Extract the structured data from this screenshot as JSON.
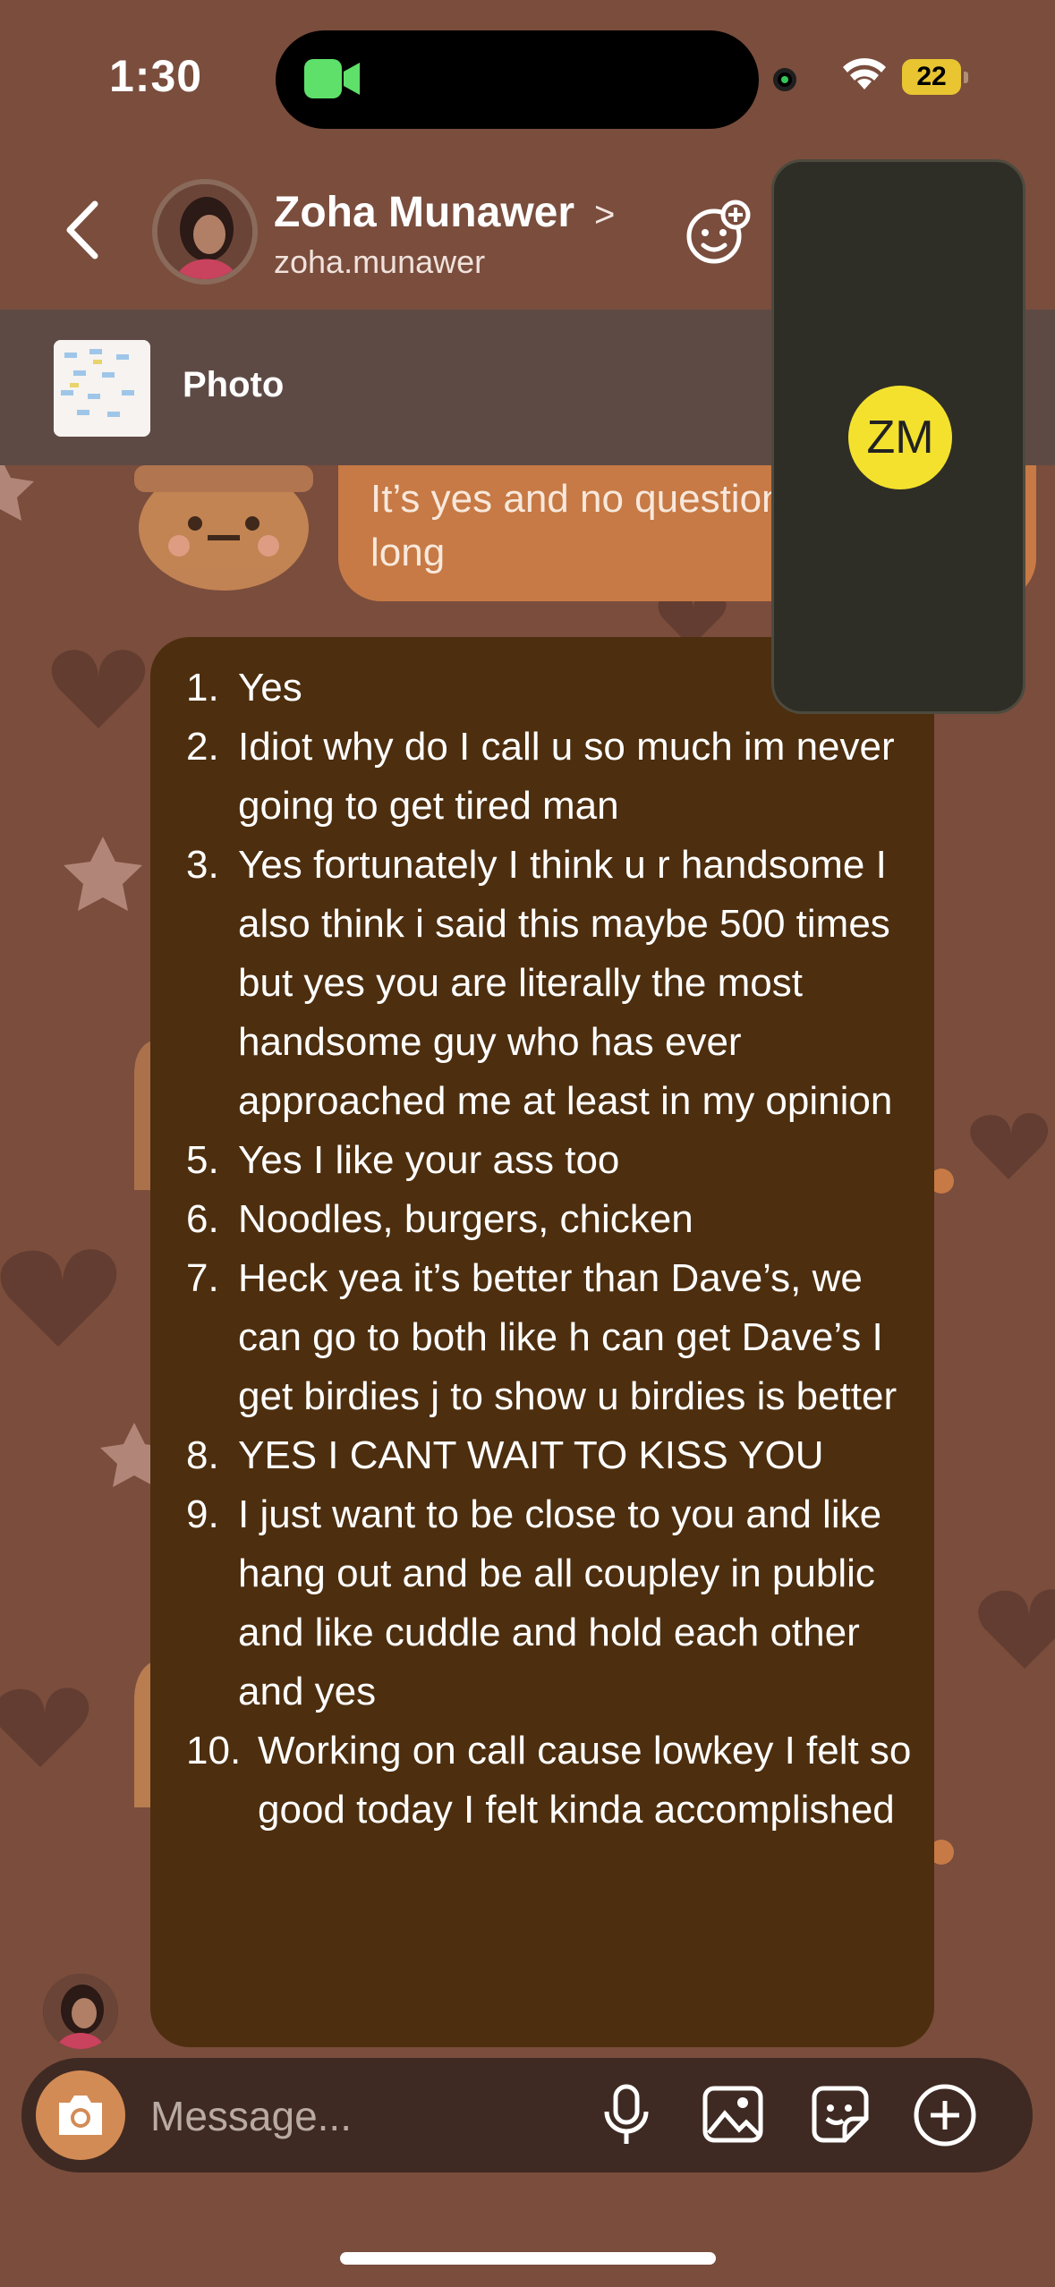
{
  "status_bar": {
    "time": "1:30",
    "battery": "22"
  },
  "header": {
    "name": "Zoha Munawer",
    "chevron": ">",
    "handle": "zoha.munawer"
  },
  "pinned": {
    "label": "Photo"
  },
  "outgoing_message": {
    "text": "It’s yes and no question taking so long"
  },
  "incoming_message": {
    "items": [
      {
        "num": "1.",
        "text": "Yes"
      },
      {
        "num": "2.",
        "text": "Idiot why do I call u so much im never going to get tired man"
      },
      {
        "num": "3.",
        "text": "Yes fortunately I think u r handsome I also think i said this maybe 500 times but yes you are literally the most handsome guy who has ever approached me at least in my opinion"
      },
      {
        "num": "5.",
        "text": "Yes I like your ass too"
      },
      {
        "num": "6.",
        "text": "Noodles, burgers, chicken"
      },
      {
        "num": "7.",
        "text": "Heck yea it’s better than Dave’s, we can go to both like h can get Dave’s I get birdies j to show u birdies is better"
      },
      {
        "num": "8.",
        "text": "YES I CANT WAIT TO KISS YOU"
      },
      {
        "num": "9.",
        "text": "I just want to be close to you and like hang out and be all coupley in public and like cuddle and hold each other and yes"
      },
      {
        "num": "10.",
        "text": "Working on call cause lowkey I felt so good today I felt kinda accomplished"
      }
    ]
  },
  "call_window": {
    "initials": "ZM"
  },
  "composer": {
    "placeholder": "Message..."
  },
  "icons": {
    "camera": "camera-icon",
    "mic": "microphone-icon",
    "gallery": "gallery-icon",
    "sticker": "sticker-icon",
    "plus": "plus-icon",
    "back": "back-icon",
    "mask": "effects-icon"
  },
  "colors": {
    "background": "#7a4d3d",
    "incoming_bubble": "#4d2e0e",
    "outgoing_bubble": "#c77a45",
    "camera_button": "#d38b55",
    "call_avatar": "#f3e12e"
  }
}
